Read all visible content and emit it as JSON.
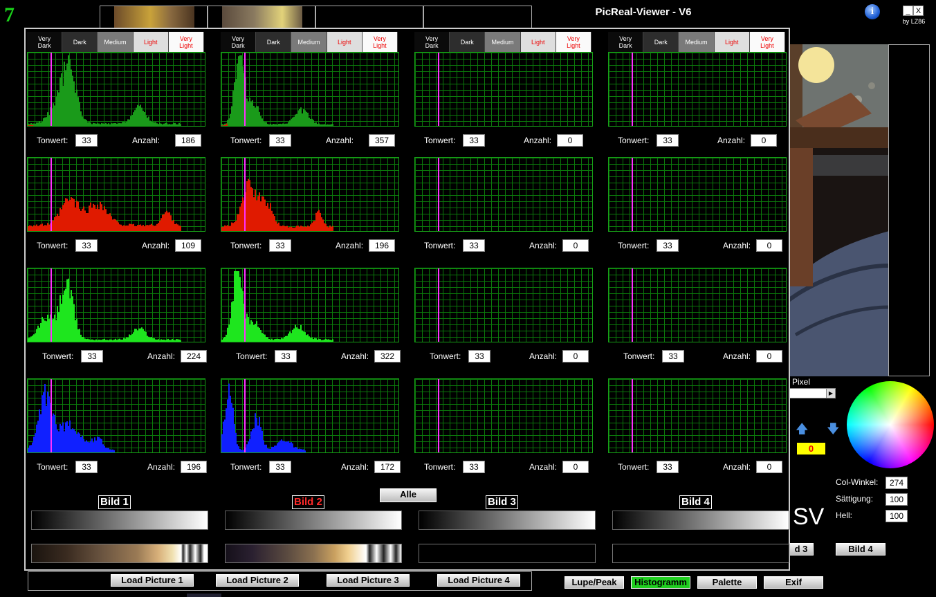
{
  "app": {
    "title": "PicReal-Viewer - V6",
    "byline": "by LZ86",
    "logo": "7"
  },
  "window_controls": {
    "minimize": "_",
    "close": "X"
  },
  "tone_labels": [
    [
      "Very",
      "Dark"
    ],
    [
      "Dark"
    ],
    [
      "Medium"
    ],
    [
      "Light"
    ],
    [
      "Very",
      "Light"
    ]
  ],
  "columns": [
    {
      "label": "Bild 1",
      "label_color": "#ffffff",
      "readouts": [
        {
          "tonwert": "33",
          "anzahl": "186"
        },
        {
          "tonwert": "33",
          "anzahl": "109"
        },
        {
          "tonwert": "33",
          "anzahl": "224"
        },
        {
          "tonwert": "33",
          "anzahl": "196"
        }
      ]
    },
    {
      "label": "Bild 2",
      "label_color": "#ff2a2a",
      "readouts": [
        {
          "tonwert": "33",
          "anzahl": "357"
        },
        {
          "tonwert": "33",
          "anzahl": "196"
        },
        {
          "tonwert": "33",
          "anzahl": "322"
        },
        {
          "tonwert": "33",
          "anzahl": "172"
        }
      ]
    },
    {
      "label": "Bild 3",
      "label_color": "#ffffff",
      "readouts": [
        {
          "tonwert": "33",
          "anzahl": "0"
        },
        {
          "tonwert": "33",
          "anzahl": "0"
        },
        {
          "tonwert": "33",
          "anzahl": "0"
        },
        {
          "tonwert": "33",
          "anzahl": "0"
        }
      ]
    },
    {
      "label": "Bild 4",
      "label_color": "#ffffff",
      "readouts": [
        {
          "tonwert": "33",
          "anzahl": "0"
        },
        {
          "tonwert": "33",
          "anzahl": "0"
        },
        {
          "tonwert": "33",
          "anzahl": "0"
        },
        {
          "tonwert": "33",
          "anzahl": "0"
        }
      ]
    }
  ],
  "readout_labels": {
    "tonwert": "Tonwert:",
    "anzahl": "Anzahl:"
  },
  "channel_colors": {
    "luminance": "#1a9a1a",
    "red": "#e01a00",
    "green": "#1ee61e",
    "blue": "#1020ff",
    "marker": "#ff30ff",
    "grid": "#0b7a0b"
  },
  "alle_button": "Alle",
  "load_buttons": [
    "Load Picture 1",
    "Load Picture 2",
    "Load Picture 3",
    "Load Picture 4"
  ],
  "bottom_buttons": {
    "lupe": "Lupe/Peak",
    "histogramm": "Histogramm",
    "palette": "Palette",
    "exif": "Exif"
  },
  "side": {
    "pixel_label": "Pixel",
    "counter": "0",
    "sv": "SV",
    "col_winkel_label": "Col-Winkel:",
    "col_winkel": "274",
    "saettigung_label": "Sättigung:",
    "saettigung": "100",
    "hell_label": "Hell:",
    "hell": "100",
    "bild3_btn": "d 3",
    "bild4_btn": "Bild 4"
  }
}
